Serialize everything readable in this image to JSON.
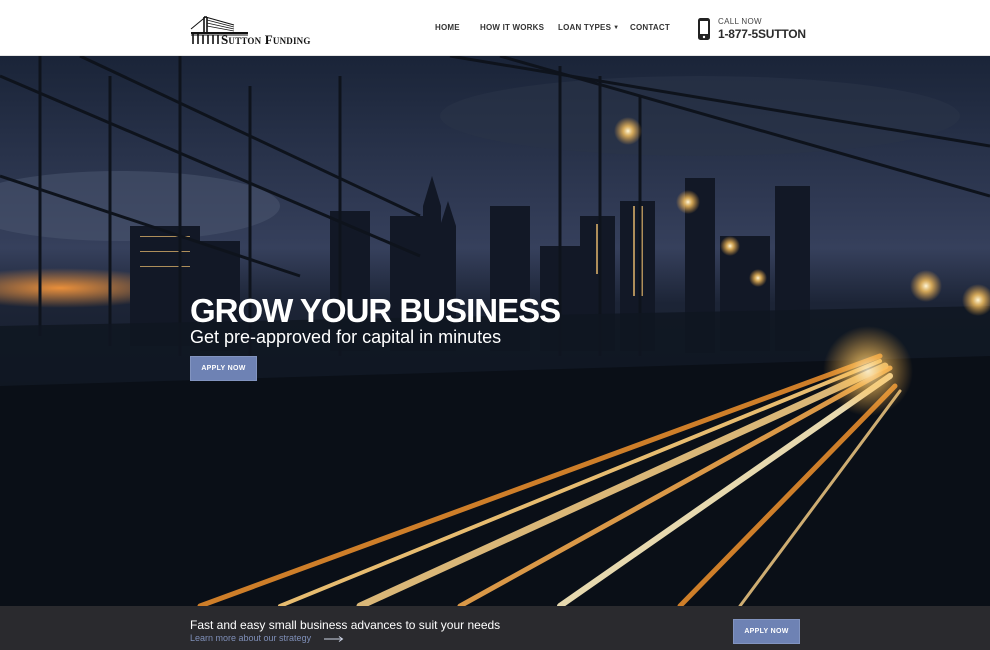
{
  "brand": {
    "name": "Sutton Funding"
  },
  "nav": {
    "items": [
      {
        "label": "HOME"
      },
      {
        "label": "HOW IT WORKS"
      },
      {
        "label": "LOAN TYPES"
      },
      {
        "label": "CONTACT"
      }
    ]
  },
  "contact": {
    "label": "CALL NOW",
    "number": "1-877-5SUTTON"
  },
  "hero": {
    "title": "GROW YOUR BUSINESS",
    "subtitle": "Get pre-approved for capital in minutes",
    "button": "APPLY NOW"
  },
  "footer_bar": {
    "title": "Fast and easy small business advances to suit your needs",
    "link": "Learn more about our strategy",
    "button": "APPLY NOW"
  },
  "colors": {
    "accent": "#6e82b4",
    "bar": "#2a2a2e",
    "link": "#7f8fb8"
  },
  "icons": [
    "bridge-logo-icon",
    "caret-down-icon",
    "phone-icon",
    "arrow-right-icon"
  ]
}
